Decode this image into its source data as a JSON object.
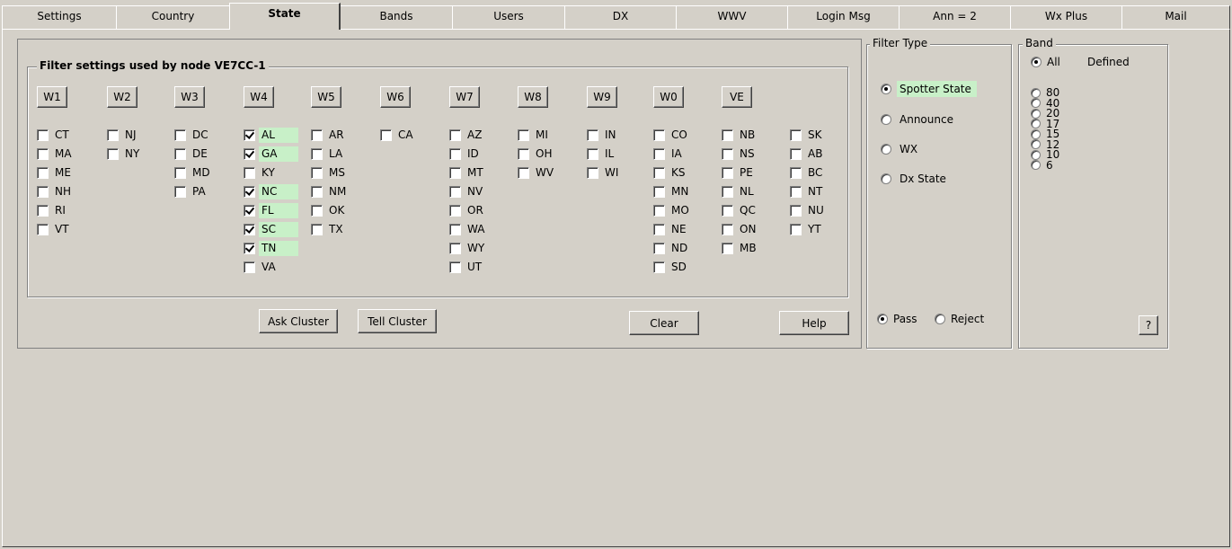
{
  "tabs": [
    {
      "label": "Settings",
      "active": false
    },
    {
      "label": "Country",
      "active": false
    },
    {
      "label": "State",
      "active": true
    },
    {
      "label": "Bands",
      "active": false
    },
    {
      "label": "Users",
      "active": false
    },
    {
      "label": "DX",
      "active": false
    },
    {
      "label": "WWV",
      "active": false
    },
    {
      "label": "Login Msg",
      "active": false
    },
    {
      "label": "Ann = 2",
      "active": false
    },
    {
      "label": "Wx Plus",
      "active": false
    },
    {
      "label": "Mail",
      "active": false
    }
  ],
  "filter_settings": {
    "title": "Filter settings used by node VE7CC-1",
    "regions": [
      {
        "button": "W1",
        "states": [
          {
            "code": "CT",
            "checked": false
          },
          {
            "code": "MA",
            "checked": false
          },
          {
            "code": "ME",
            "checked": false
          },
          {
            "code": "NH",
            "checked": false
          },
          {
            "code": "RI",
            "checked": false
          },
          {
            "code": "VT",
            "checked": false
          }
        ]
      },
      {
        "button": "W2",
        "states": [
          {
            "code": "NJ",
            "checked": false
          },
          {
            "code": "NY",
            "checked": false
          }
        ]
      },
      {
        "button": "W3",
        "states": [
          {
            "code": "DC",
            "checked": false
          },
          {
            "code": "DE",
            "checked": false
          },
          {
            "code": "MD",
            "checked": false
          },
          {
            "code": "PA",
            "checked": false
          }
        ]
      },
      {
        "button": "W4",
        "states": [
          {
            "code": "AL",
            "checked": true
          },
          {
            "code": "GA",
            "checked": true
          },
          {
            "code": "KY",
            "checked": false
          },
          {
            "code": "NC",
            "checked": true
          },
          {
            "code": "FL",
            "checked": true
          },
          {
            "code": "SC",
            "checked": true
          },
          {
            "code": "TN",
            "checked": true
          },
          {
            "code": "VA",
            "checked": false
          }
        ]
      },
      {
        "button": "W5",
        "states": [
          {
            "code": "AR",
            "checked": false
          },
          {
            "code": "LA",
            "checked": false
          },
          {
            "code": "MS",
            "checked": false
          },
          {
            "code": "NM",
            "checked": false
          },
          {
            "code": "OK",
            "checked": false
          },
          {
            "code": "TX",
            "checked": false
          }
        ]
      },
      {
        "button": "W6",
        "states": [
          {
            "code": "CA",
            "checked": false
          }
        ]
      },
      {
        "button": "W7",
        "states": [
          {
            "code": "AZ",
            "checked": false
          },
          {
            "code": "ID",
            "checked": false
          },
          {
            "code": "MT",
            "checked": false
          },
          {
            "code": "NV",
            "checked": false
          },
          {
            "code": "OR",
            "checked": false
          },
          {
            "code": "WA",
            "checked": false
          },
          {
            "code": "WY",
            "checked": false
          },
          {
            "code": "UT",
            "checked": false
          }
        ]
      },
      {
        "button": "W8",
        "states": [
          {
            "code": "MI",
            "checked": false
          },
          {
            "code": "OH",
            "checked": false
          },
          {
            "code": "WV",
            "checked": false
          }
        ]
      },
      {
        "button": "W9",
        "states": [
          {
            "code": "IN",
            "checked": false
          },
          {
            "code": "IL",
            "checked": false
          },
          {
            "code": "WI",
            "checked": false
          }
        ]
      },
      {
        "button": "W0",
        "states": [
          {
            "code": "CO",
            "checked": false
          },
          {
            "code": "IA",
            "checked": false
          },
          {
            "code": "KS",
            "checked": false
          },
          {
            "code": "MN",
            "checked": false
          },
          {
            "code": "MO",
            "checked": false
          },
          {
            "code": "NE",
            "checked": false
          },
          {
            "code": "ND",
            "checked": false
          },
          {
            "code": "SD",
            "checked": false
          }
        ]
      },
      {
        "button": "VE",
        "states": [
          {
            "code": "NB",
            "checked": false
          },
          {
            "code": "NS",
            "checked": false
          },
          {
            "code": "PE",
            "checked": false
          },
          {
            "code": "NL",
            "checked": false
          },
          {
            "code": "QC",
            "checked": false
          },
          {
            "code": "ON",
            "checked": false
          },
          {
            "code": "MB",
            "checked": false
          }
        ]
      },
      {
        "button": "",
        "states": [
          {
            "code": "SK",
            "checked": false
          },
          {
            "code": "AB",
            "checked": false
          },
          {
            "code": "BC",
            "checked": false
          },
          {
            "code": "NT",
            "checked": false
          },
          {
            "code": "NU",
            "checked": false
          },
          {
            "code": "YT",
            "checked": false
          }
        ]
      }
    ],
    "highlight_color": "#c8f0c8"
  },
  "actions": {
    "ask_cluster": "Ask Cluster",
    "tell_cluster": "Tell Cluster",
    "clear": "Clear",
    "help": "Help"
  },
  "filter_type": {
    "title": "Filter Type",
    "options": [
      {
        "label": "Spotter State",
        "selected": true
      },
      {
        "label": "Announce",
        "selected": false
      },
      {
        "label": "WX",
        "selected": false
      },
      {
        "label": "Dx State",
        "selected": false
      }
    ],
    "pass_label": "Pass",
    "reject_label": "Reject",
    "pass_selected": true
  },
  "band": {
    "title": "Band",
    "all_label": "All",
    "defined_label": "Defined",
    "all_selected": true,
    "bands": [
      "80",
      "40",
      "20",
      "17",
      "15",
      "12",
      "10",
      "6"
    ],
    "help_button": "?"
  }
}
